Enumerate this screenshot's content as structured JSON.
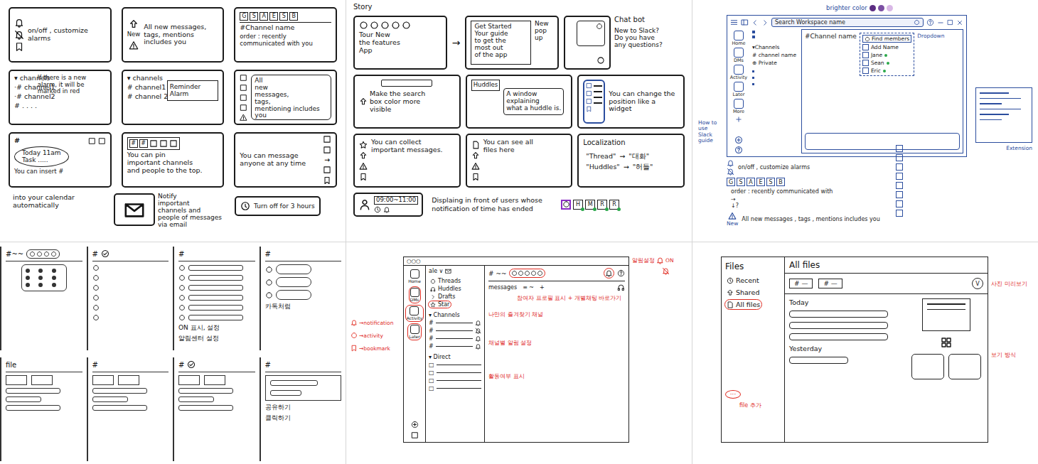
{
  "ideas": {
    "frames": [
      {
        "kind": "alarm",
        "lines": [
          "on/off , customize",
          "alarms"
        ]
      },
      {
        "kind": "new",
        "badge": "New",
        "lines": [
          "All new messages,",
          "tags, mentions includes you"
        ]
      },
      {
        "kind": "order",
        "keys": [
          "G",
          "S",
          "A",
          "E",
          "S",
          "B"
        ],
        "lines": [
          "#Channel name"
        ],
        "note": "order : recently communicated with you"
      },
      {
        "kind": "red",
        "items": [
          "▾ channels",
          "·# channel1",
          "·# channel2",
          "# . . . ."
        ],
        "note": "If there is a new alarm, it will be marked in red"
      },
      {
        "kind": "reminder",
        "items": [
          "▾ channels",
          "# channel1",
          "# channel 2"
        ],
        "note": "Reminder Alarm"
      },
      {
        "kind": "menu",
        "lines": [
          "All",
          "new",
          "messages,",
          "tags,",
          "mentioning includes you"
        ]
      },
      {
        "kind": "calendar",
        "keys": [
          "#"
        ],
        "lines": [
          "Today 11am",
          "Task ....."
        ],
        "note": "You can insert #"
      },
      {
        "kind": "pin",
        "keys": [
          "#",
          "#"
        ],
        "lines": [
          "You can pin",
          "important channels",
          "and people to the top."
        ]
      },
      {
        "kind": "dm",
        "keys": [
          "→"
        ],
        "lines": [
          "You can message",
          "anyone at any time"
        ]
      }
    ],
    "caption": "into your calendar automatically",
    "email": [
      "Notify",
      "important",
      "channels and",
      "people of messages",
      "via email"
    ],
    "snooze": "Turn off for 3 hours"
  },
  "story": {
    "title": "Story",
    "rows": [
      [
        {
          "kind": "tour",
          "lines": [
            "Tour New",
            "the features",
            "App"
          ]
        },
        {
          "kind": "arrow",
          "lines": [
            "→"
          ]
        },
        {
          "kind": "popup",
          "lines": [
            "Get Started",
            "Your guide",
            "to get the",
            "most out",
            "of the app"
          ],
          "note": "New pop up"
        },
        {
          "kind": "chatbot",
          "lines": [
            "Chat bot",
            "New to Slack?",
            "Do you have",
            "any questions?"
          ]
        }
      ],
      [
        {
          "kind": "search",
          "lines": [
            "Make the search",
            "box color more",
            "visible"
          ]
        },
        {
          "kind": "huddle",
          "badge": "Huddles",
          "lines": [
            "A window",
            "explaining",
            "what a huddle is."
          ]
        },
        {
          "kind": "widget",
          "lines": [
            "You can change the",
            "position like a widget"
          ]
        }
      ],
      [
        {
          "kind": "collect",
          "lines": [
            "You can collect",
            "important messages."
          ]
        },
        {
          "kind": "files",
          "lines": [
            "You can see all",
            "files here"
          ]
        },
        {
          "kind": "locale",
          "badge": "Localization",
          "pairs": [
            [
              "\"Thread\"",
              "→",
              "\"대화\""
            ],
            [
              "\"Huddles\"",
              "→",
              "\"허들\""
            ]
          ]
        }
      ]
    ],
    "time": "09:00~11:00",
    "display": "Displaing in front of users whose notification of time has ended",
    "avatars": [
      "H",
      "M",
      "R",
      "R"
    ]
  },
  "desktop": {
    "brighter": "brighter color",
    "swatches": [
      {
        "color": "#5b2d82"
      },
      {
        "color": "#7b4fa3"
      },
      {
        "color": "#d9b8e6"
      }
    ],
    "search": "Search Workspace name",
    "rail": [
      "Home",
      "DMs",
      "Activity",
      "Later",
      "More"
    ],
    "sidebar": [
      "▾Channels",
      "# channel name",
      "⊕ Private"
    ],
    "channel": "#Channel name",
    "dropdown": {
      "title": "Find members",
      "members": [
        {
          "name": "Add Name",
          "online": false
        },
        {
          "name": "Jane",
          "online": true
        },
        {
          "name": "Sean",
          "online": true
        },
        {
          "name": "Eric",
          "online": true
        }
      ]
    },
    "dropdownNote": "Dropdown",
    "guide": "How to use Slack guide",
    "extension": "Extension",
    "legend": {
      "alarm": "on/off , customize alarms",
      "keys": [
        "G",
        "S",
        "A",
        "E",
        "S",
        "B"
      ],
      "order": "order : recently communicated with",
      "arrows": [
        "→",
        "↓?"
      ],
      "badge": "New",
      "all": "All new messages , tags , mentions includes you"
    }
  },
  "storyboard": {
    "cells": [
      {
        "kind": "popup",
        "header": "#~~",
        "notes": []
      },
      {
        "kind": "check",
        "header": "#",
        "notes": []
      },
      {
        "kind": "list",
        "header": "#",
        "notes": [
          "ON 표시, 설정",
          "알림센터 설정"
        ]
      },
      {
        "kind": "chat",
        "header": "#",
        "notes": [
          "카톡처럼"
        ]
      },
      {
        "kind": "file",
        "header": "file",
        "notes": []
      },
      {
        "kind": "tabs",
        "header": "#",
        "notes": []
      },
      {
        "kind": "check2",
        "header": "#",
        "notes": []
      },
      {
        "kind": "preview",
        "header": "#",
        "notes": [
          "공유하기",
          "클릭하기"
        ]
      }
    ]
  },
  "mainUi": {
    "dots": "○○○",
    "workspace": "ale ∨",
    "channel": "# ~~",
    "tabs": [
      "messages",
      "≡ ~",
      "+"
    ],
    "rail": [
      "Home",
      "DMs",
      "Activity",
      "Later"
    ],
    "sidebar": [
      {
        "label": "Threads",
        "highlighted": false
      },
      {
        "label": "Huddles",
        "highlighted": false
      },
      {
        "label": "Drafts",
        "highlighted": false
      },
      {
        "label": "Star",
        "highlighted": true
      }
    ],
    "channelsTitle": "▾ Channels",
    "channels": [
      {
        "name": "#",
        "muted": false
      },
      {
        "name": "#",
        "muted": true
      },
      {
        "name": "#",
        "muted": false
      },
      {
        "name": "#",
        "muted": false
      }
    ],
    "directTitle": "▾ Direct",
    "direct": [
      "□",
      "□",
      "□",
      "□"
    ],
    "notes": {
      "bellTitle": "알림설정",
      "on": "ON",
      "avatars": "참여자 프로필 표시 + 개별채팅 바로가기",
      "rail": [
        "→notification",
        "→activity",
        "→bookmark"
      ],
      "star": "나만의 즐겨찾기 채널",
      "bells": "채널별 알림 설정",
      "direct": "활동여부 표시"
    }
  },
  "files": {
    "title": "Files",
    "nav": [
      {
        "label": "Recent",
        "selected": false
      },
      {
        "label": "Shared",
        "selected": false
      },
      {
        "label": "All files",
        "selected": true
      }
    ],
    "more": "···",
    "moreNote": "file 추가",
    "heading": "All files",
    "chips": [
      "# —",
      "# —"
    ],
    "upload": "V",
    "uploadNote": "사진 미리보기",
    "today": "Today",
    "yesterday": "Yesterday",
    "viewNote": "보기 방식"
  }
}
